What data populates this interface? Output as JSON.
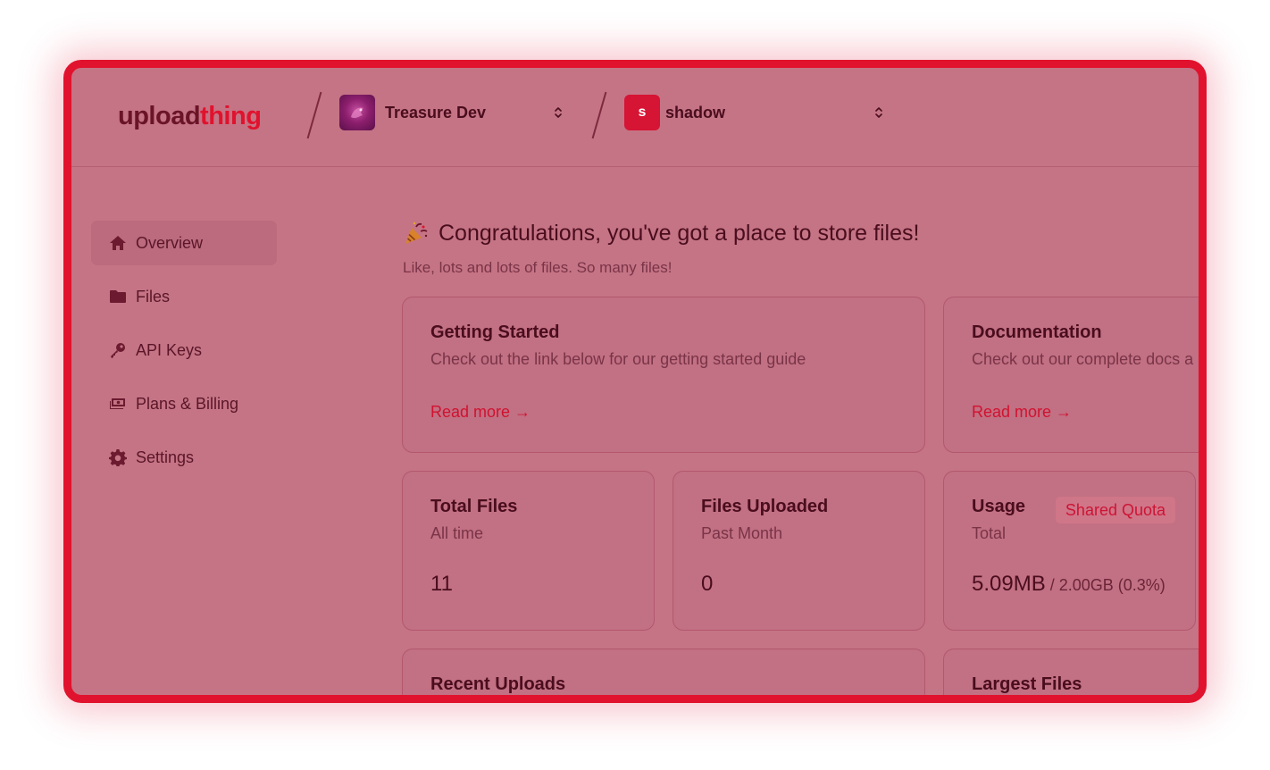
{
  "brand": {
    "part1": "upload",
    "part2": "thing"
  },
  "header": {
    "app_selector": {
      "label": "Treasure Dev",
      "icon": "treasure-dev-avatar"
    },
    "env_selector": {
      "label": "shadow",
      "initial": "s"
    }
  },
  "sidebar": {
    "items": [
      {
        "label": "Overview",
        "icon": "home-icon",
        "active": true
      },
      {
        "label": "Files",
        "icon": "folder-icon"
      },
      {
        "label": "API Keys",
        "icon": "key-icon"
      },
      {
        "label": "Plans & Billing",
        "icon": "billing-icon"
      },
      {
        "label": "Settings",
        "icon": "gear-icon"
      }
    ]
  },
  "main": {
    "title": "Congratulations, you've got a place to store files!",
    "subtitle": "Like, lots and lots of files. So many files!",
    "cards": [
      {
        "title": "Getting Started",
        "desc": "Check out the link below for our getting started guide",
        "link": "Read more →"
      },
      {
        "title": "Documentation",
        "desc": "Check out our complete docs a",
        "link": "Read more →"
      }
    ],
    "stats": {
      "total_files": {
        "title": "Total Files",
        "sub": "All time",
        "value": "11"
      },
      "files_uploaded": {
        "title": "Files Uploaded",
        "sub": "Past Month",
        "value": "0"
      },
      "usage": {
        "title": "Usage",
        "sub": "Total",
        "badge": "Shared Quota",
        "value": "5.09MB",
        "detail": " / 2.00GB (0.3%)"
      }
    },
    "bottom_cards": [
      {
        "title": "Recent Uploads"
      },
      {
        "title": "Largest Files"
      }
    ]
  },
  "colors": {
    "accent": "#e1122d",
    "overlay": "#c57485",
    "text_dark": "#4a0d1d"
  }
}
